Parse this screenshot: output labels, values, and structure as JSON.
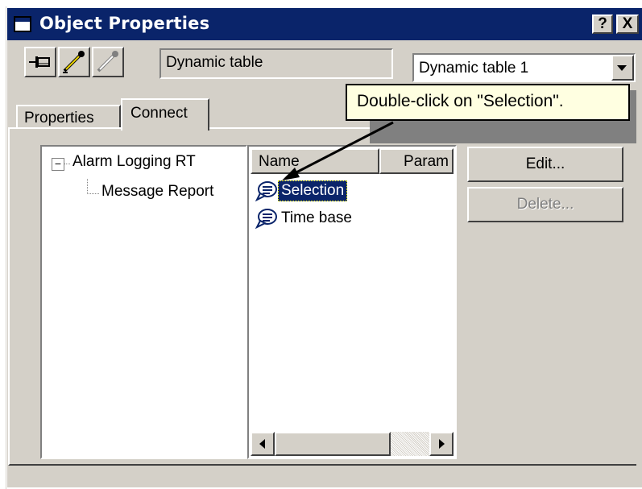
{
  "window": {
    "title": "Object Properties",
    "help_button": "?",
    "close_button": "X"
  },
  "toolbar": {
    "pin_icon": "pin-icon",
    "edit_icon": "pipette-icon",
    "disabled_edit_icon": "pipette-disabled-icon",
    "object_type": "Dynamic table",
    "object_name": "Dynamic table 1"
  },
  "tabs": [
    {
      "label": "Properties"
    },
    {
      "label": "Connect"
    }
  ],
  "tree": {
    "root_label": "Alarm Logging RT",
    "root_expander": "−",
    "child_label": "Message Report"
  },
  "list": {
    "columns": [
      "Name",
      "Param"
    ],
    "items": [
      {
        "label": "Selection",
        "selected": true
      },
      {
        "label": "Time base",
        "selected": false
      }
    ]
  },
  "buttons": {
    "edit": "Edit...",
    "delete": "Delete..."
  },
  "tooltip": {
    "text": "Double-click on \"Selection\"."
  },
  "colors": {
    "title_bar": "#0a246a",
    "face": "#d4d0c8",
    "tooltip_bg": "#ffffe1",
    "selection_bg": "#0a246a"
  }
}
